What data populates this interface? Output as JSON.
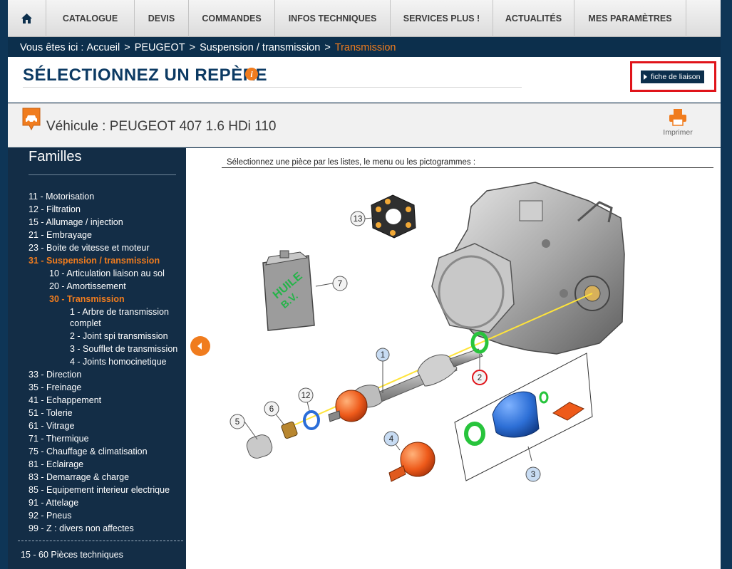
{
  "nav": {
    "home_icon": "home-icon",
    "items": [
      "CATALOGUE",
      "DEVIS",
      "COMMANDES",
      "INFOS TECHNIQUES",
      "SERVICES PLUS !",
      "ACTUALITÉS",
      "MES PARAMÈTRES"
    ]
  },
  "breadcrumb": {
    "prefix": "Vous êtes ici :",
    "items": [
      "Accueil",
      "PEUGEOT",
      "Suspension / transmission",
      "Transmission"
    ],
    "separator": ">"
  },
  "header": {
    "title": "SÉLECTIONNEZ UN REPÈRE",
    "info_icon": "i",
    "fiche_button": "fiche de liaison"
  },
  "vehicle": {
    "label": "Véhicule : PEUGEOT 407 1.6 HDi 110",
    "print_label": "Imprimer"
  },
  "sidebar": {
    "title": "Familles",
    "families_before": [
      "11 - Motorisation",
      "12 - Filtration",
      "15 - Allumage / injection",
      "21 - Embrayage",
      "23 - Boite de vitesse et moteur"
    ],
    "active_family": "31 - Suspension / transmission",
    "subfamilies_before": [
      "10 - Articulation liaison au sol",
      "20 - Amortissement"
    ],
    "active_subfamily": "30 - Transmission",
    "parts": [
      "1 - Arbre de transmission complet",
      "2 - Joint spi transmission",
      "3 - Soufflet de transmission",
      "4 - Joints homocinetique"
    ],
    "families_after": [
      "33 - Direction",
      "35 - Freinage",
      "41 - Echappement",
      "51 - Tolerie",
      "61 - Vitrage",
      "71 - Thermique",
      "75 - Chauffage & climatisation",
      "81 - Eclairage",
      "83 - Demarrage & charge",
      "85 - Equipement interieur electrique",
      "91 - Attelage",
      "92 - Pneus",
      "99 - Z : divers non affectes"
    ],
    "footer": "15 - 60 Pièces techniques"
  },
  "main": {
    "instruction": "Sélectionnez une pièce par les listes, le menu ou les pictogrammes :",
    "oil_can_text": [
      "HUILE",
      "B.V."
    ],
    "callouts": [
      "1",
      "2",
      "3",
      "4",
      "5",
      "6",
      "7",
      "12",
      "13"
    ]
  },
  "colors": {
    "navy": "#0c2f4c",
    "sidebar": "#132d46",
    "accent": "#f07c1e",
    "highlight": "#e0141a",
    "title": "#0c3a63"
  }
}
